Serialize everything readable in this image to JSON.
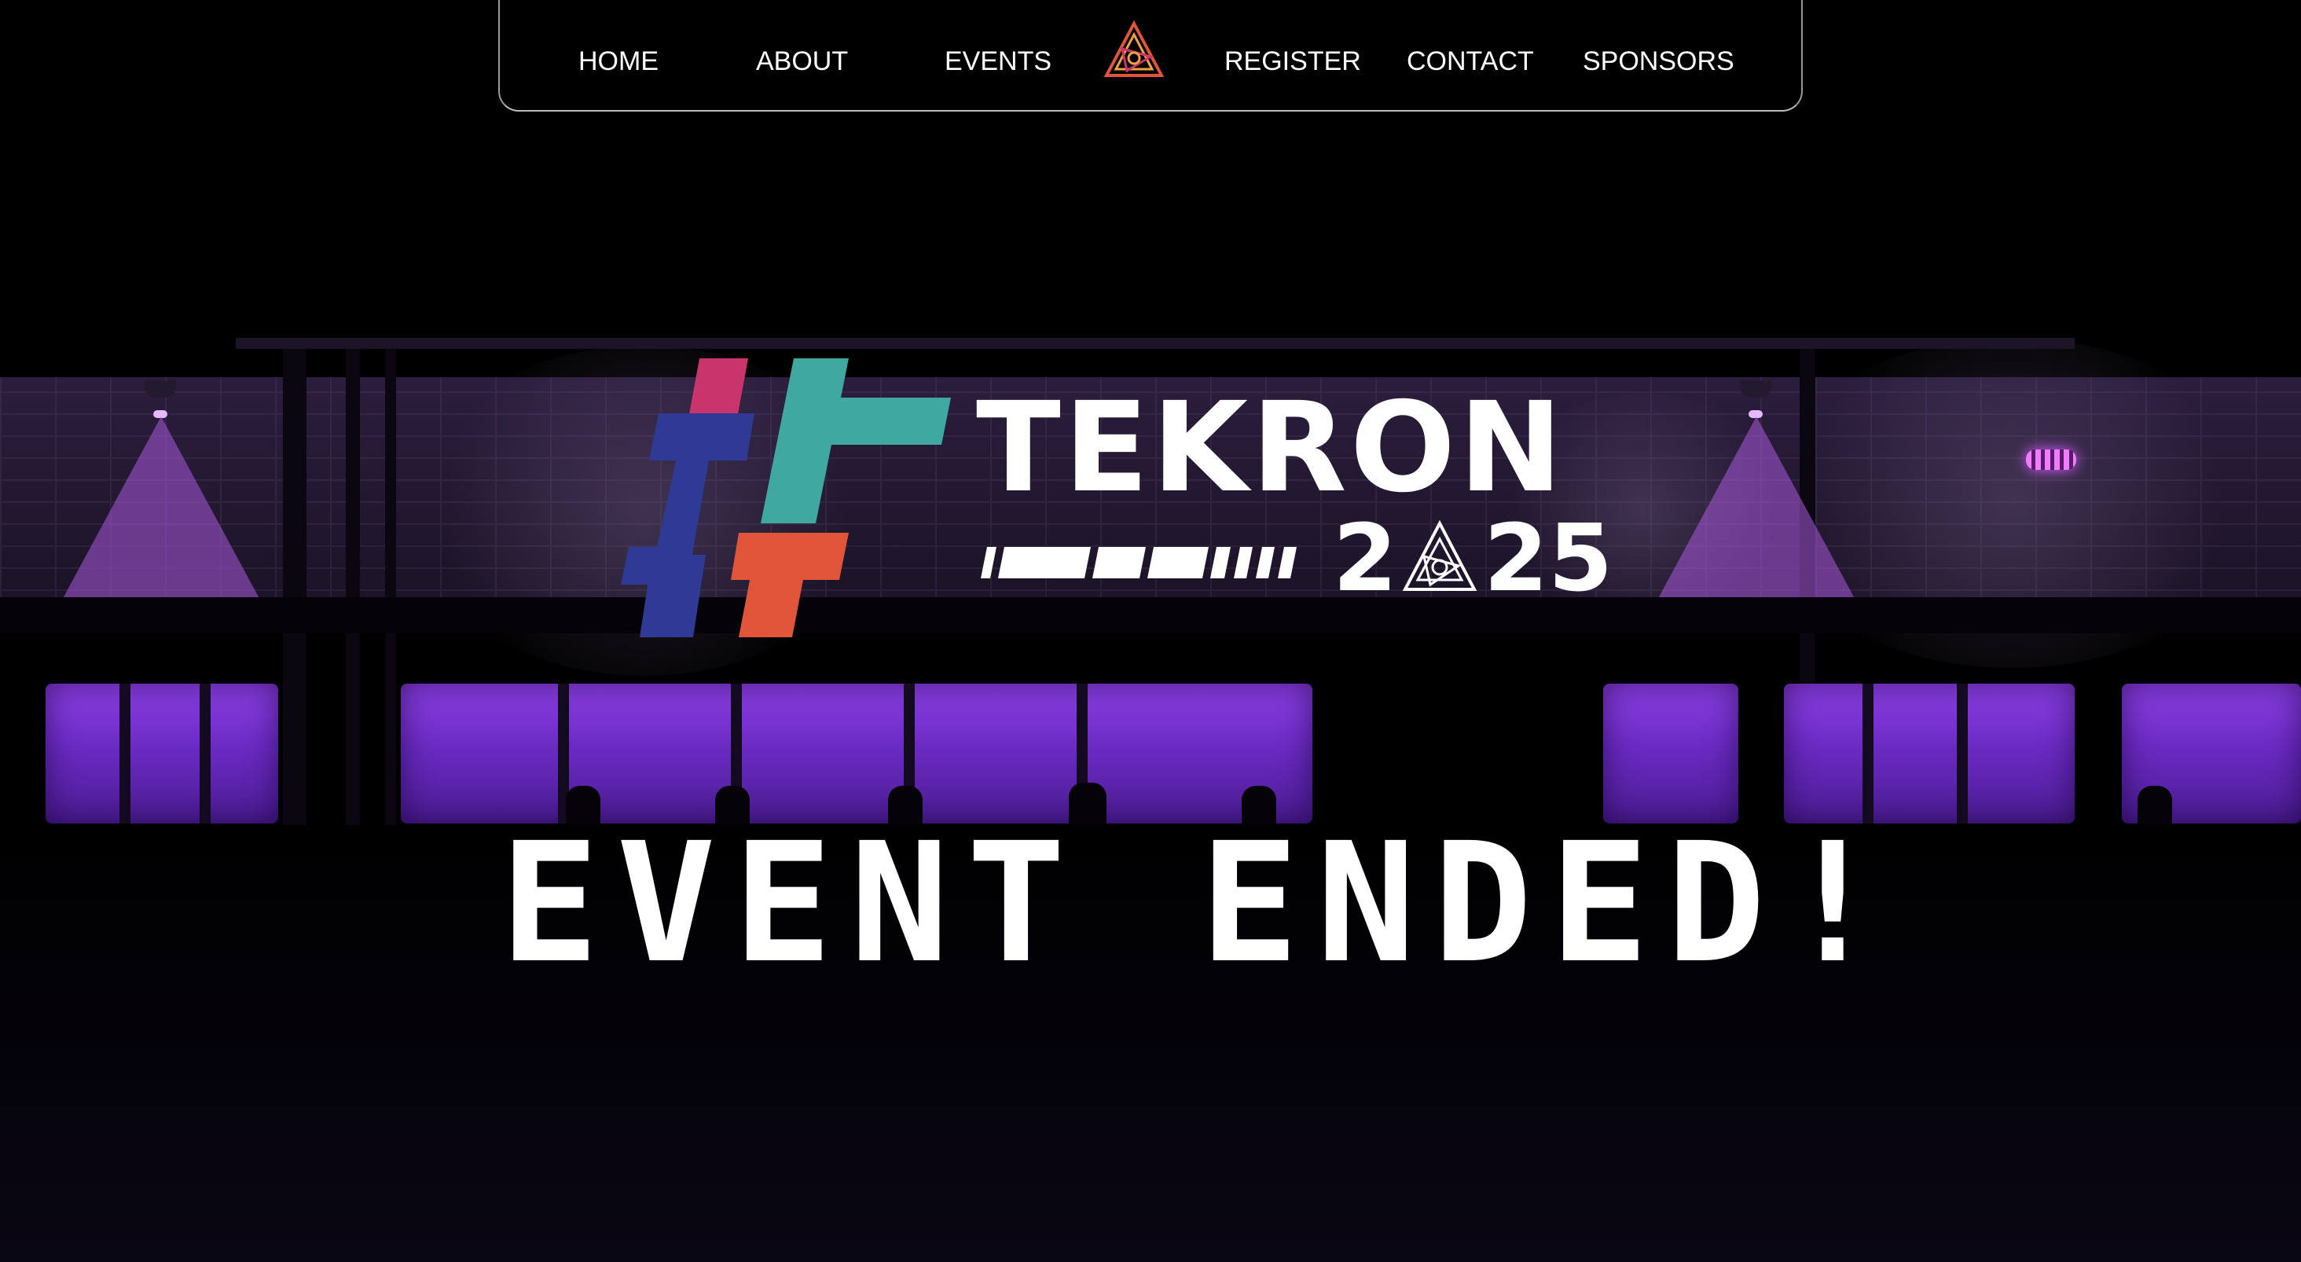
{
  "nav": {
    "links": [
      {
        "label": "HOME"
      },
      {
        "label": "ABOUT"
      },
      {
        "label": "EVENTS"
      },
      {
        "label": "REGISTER"
      },
      {
        "label": "CONTACT"
      },
      {
        "label": "SPONSORS"
      }
    ],
    "logo_icon": "tekron-triangle-emblem-icon"
  },
  "hero": {
    "brand": "TEKRON",
    "year_left": "2",
    "year_right": "25",
    "year_emblem_icon": "triangle-emblem-icon",
    "hashtag_icon": "hashtag-logo-icon",
    "headline": "EVENT ENDED!"
  },
  "colors": {
    "background": "#000000",
    "neon_purple": "#8e40e6",
    "hashtag_pink": "#c9356b",
    "hashtag_teal": "#3fa8a0",
    "hashtag_blue": "#2e3a94",
    "hashtag_orange": "#e0553a"
  }
}
